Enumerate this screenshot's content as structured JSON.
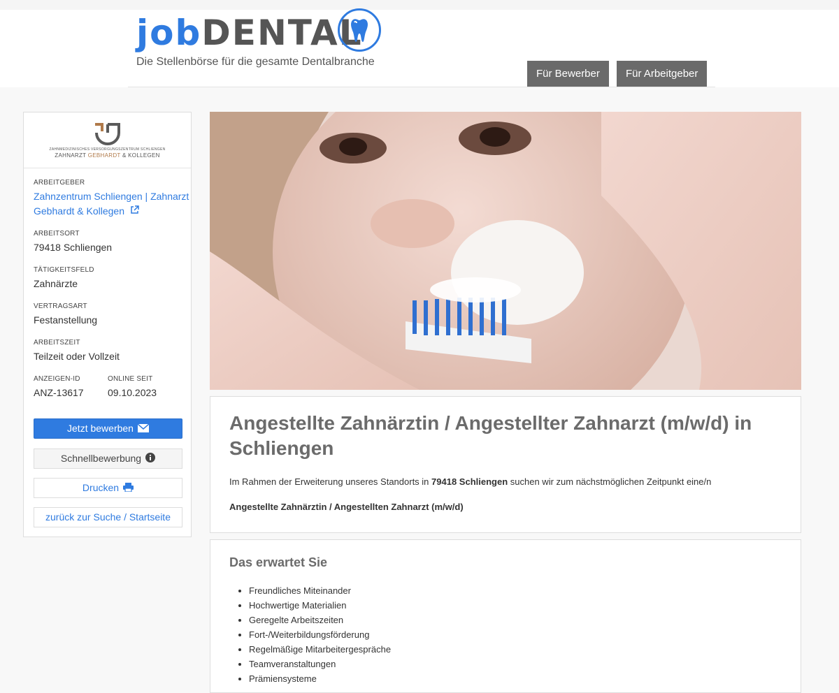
{
  "header": {
    "logo_part1": "job",
    "logo_part2": "DENTAL",
    "tagline": "Die Stellenbörse für die gesamte Dentalbranche",
    "nav": [
      "Für Bewerber",
      "Für Arbeitgeber"
    ]
  },
  "sidebar": {
    "logo_line1": "ZAHNMEDIZINISCHES VERSORGUNGSZENTRUM SCHLIENGEN",
    "logo_line2a": "ZAHNARZT",
    "logo_line2b": "GEBHARDT",
    "logo_line2c": "& KOLLEGEN",
    "employer_label": "ARBEITGEBER",
    "employer_line1": "Zahnzentrum Schliengen | Zahnarzt",
    "employer_line2": "Gebhardt & Kollegen",
    "location_label": "ARBEITSORT",
    "location": "79418 Schliengen",
    "field_label": "TÄTIGKEITSFELD",
    "field": "Zahnärzte",
    "contract_label": "VERTRAGSART",
    "contract": "Festanstellung",
    "worktime_label": "ARBEITSZEIT",
    "worktime": "Teilzeit oder Vollzeit",
    "adid_label": "ANZEIGEN-ID",
    "adid": "ANZ-13617",
    "online_label": "ONLINE SEIT",
    "online": "09.10.2023",
    "btn_apply": "Jetzt bewerben",
    "btn_quick": "Schnellbewerbung",
    "btn_print": "Drucken",
    "btn_back": "zurück zur Suche / Startseite"
  },
  "job": {
    "title": "Angestellte Zahnärztin / Angestellter Zahnarzt (m/w/d) in Schliengen",
    "intro_pre": "Im Rahmen der Erweiterung unseres Standorts in ",
    "intro_bold": "79418 Schliengen",
    "intro_post": " suchen wir zum nächstmöglichen Zeitpunkt eine/n",
    "subtitle": "Angestellte Zahnärztin / Angestellten Zahnarzt (m/w/d)"
  },
  "expect": {
    "heading": "Das erwartet Sie",
    "items": [
      "Freundliches Miteinander",
      "Hochwertige Materialien",
      "Geregelte Arbeitszeiten",
      "Fort-/Weiterbildungsförderung",
      "Regelmäßige Mitarbeitergespräche",
      "Teamveranstaltungen",
      "Prämiensysteme"
    ]
  },
  "colors": {
    "accent": "#2f7be0",
    "nav_bg": "#6a6a6a",
    "heading": "#6b6b6b"
  }
}
